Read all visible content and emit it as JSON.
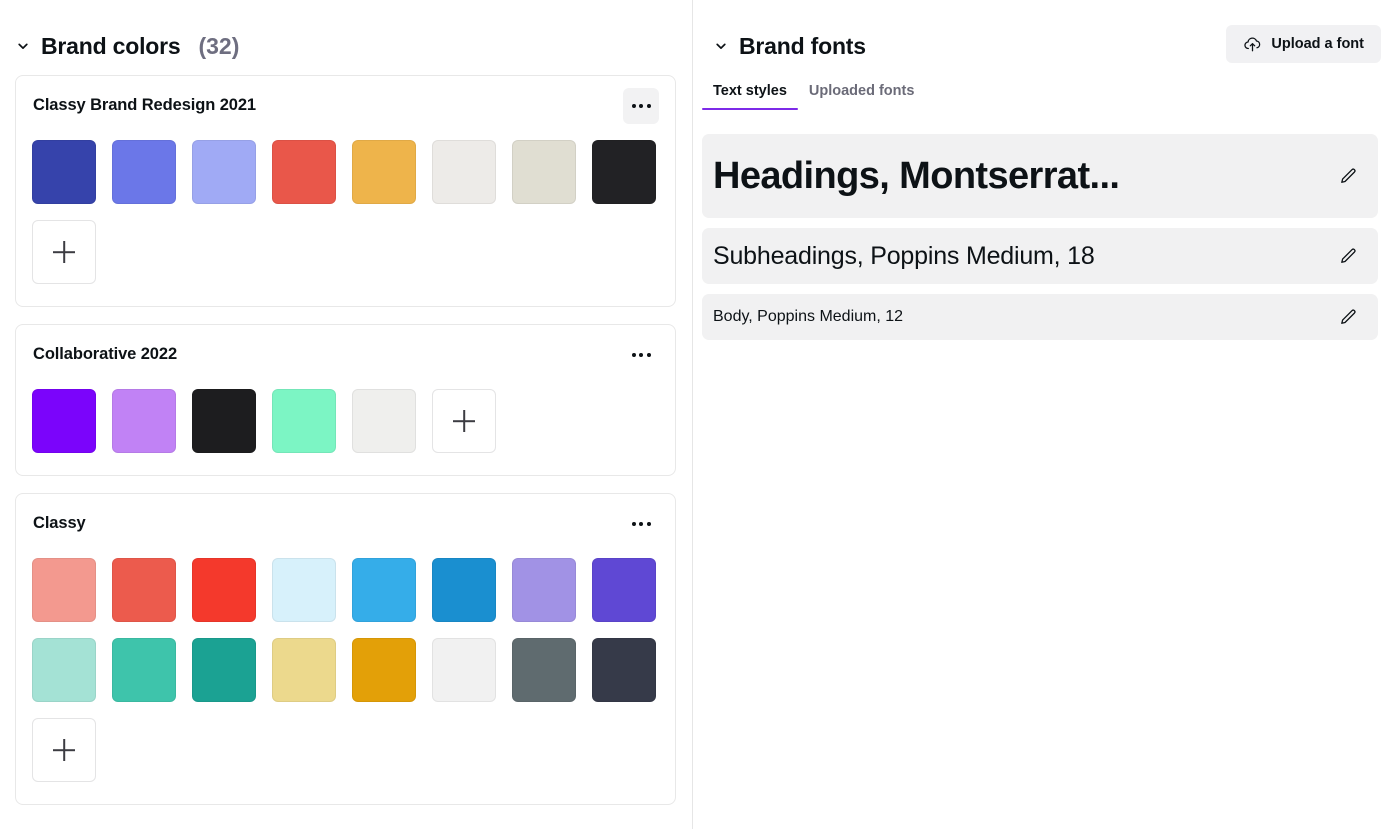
{
  "brand_colors": {
    "title": "Brand colors",
    "count": "(32)",
    "collapse_icon": "chevron-down-icon",
    "palettes": [
      {
        "name": "Classy Brand Redesign 2021",
        "menu_icon": "more-options-icon",
        "menu_hovered": true,
        "add_label": "+",
        "add_inline": false,
        "rows": [
          [
            "#3643ab",
            "#6b77e8",
            "#a0aaf5",
            "#e9574a",
            "#eeb44b",
            "#edebe8",
            "#e0ded2",
            "#222225"
          ]
        ]
      },
      {
        "name": "Collaborative 2022",
        "menu_icon": "more-options-icon",
        "menu_hovered": false,
        "add_label": "+",
        "add_inline": true,
        "rows": [
          [
            "#7b04fb",
            "#c182f5",
            "#1d1d1f",
            "#7cf5c4",
            "#efefed"
          ]
        ]
      },
      {
        "name": "Classy",
        "menu_icon": "more-options-icon",
        "menu_hovered": false,
        "add_label": "+",
        "add_inline": false,
        "rows": [
          [
            "#f3998f",
            "#ec5b4d",
            "#f4392c",
            "#d7f1fb",
            "#35ade9",
            "#1a8fd0",
            "#a192e5",
            "#5f48d4"
          ],
          [
            "#a4e2d5",
            "#3ec4ab",
            "#1ba293",
            "#ecd98d",
            "#e3a008",
            "#f1f1f1",
            "#5f6b6f",
            "#363a49"
          ]
        ]
      }
    ]
  },
  "brand_fonts": {
    "title": "Brand fonts",
    "collapse_icon": "chevron-down-icon",
    "upload_button": {
      "label": "Upload a font",
      "icon": "cloud-upload-icon"
    },
    "tabs": [
      {
        "label": "Text styles",
        "active": true
      },
      {
        "label": "Uploaded fonts",
        "active": false
      }
    ],
    "text_styles": [
      {
        "text": "Headings, Montserrat...",
        "edit_icon": "pencil-icon"
      },
      {
        "text": "Subheadings, Poppins Medium, 18",
        "edit_icon": "pencil-icon"
      },
      {
        "text": "Body, Poppins Medium, 12",
        "edit_icon": "pencil-icon"
      }
    ]
  },
  "colors": {
    "accent": "#7d2ae8",
    "text": "#0d1216",
    "muted": "#6e6e80",
    "row_bg": "#f1f1f2",
    "border": "#e8e8e8"
  }
}
